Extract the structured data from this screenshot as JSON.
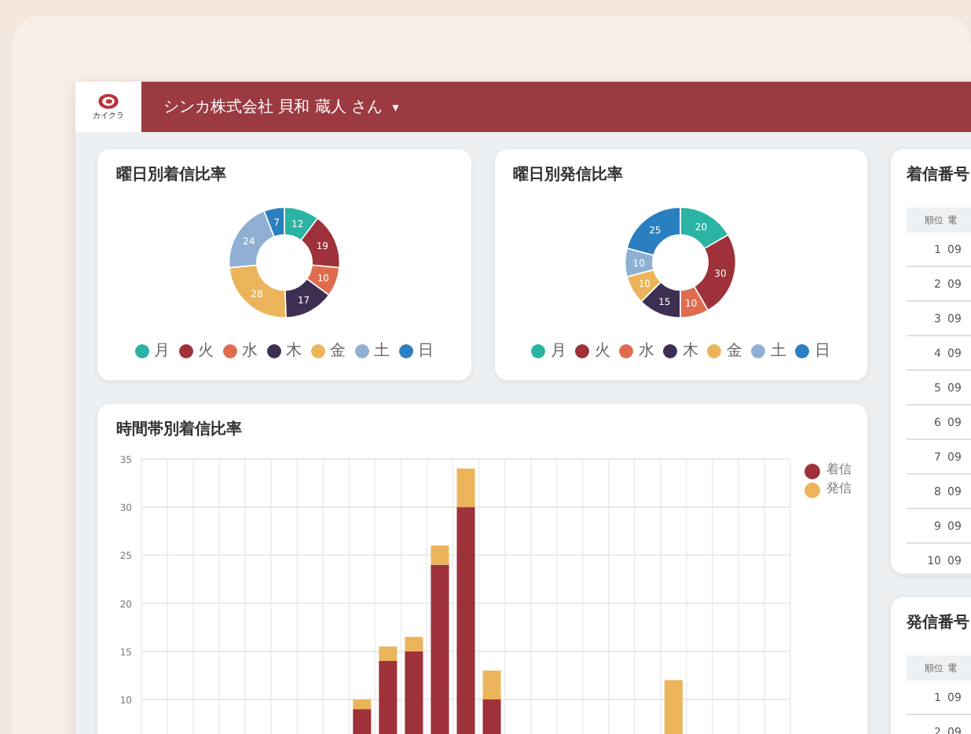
{
  "header": {
    "logo_text": "カイクラ",
    "user": "シンカ株式会社 貝和 蔵人 さん",
    "menu_caret": "▾"
  },
  "donuts": [
    {
      "chart_data": {
        "type": "donut",
        "title": "曜日別着信比率",
        "categories": [
          "月",
          "火",
          "水",
          "木",
          "金",
          "土",
          "日"
        ],
        "values": [
          12,
          19,
          10,
          17,
          28,
          24,
          7
        ],
        "colors": [
          "#2bb3a3",
          "#9e3139",
          "#e06c4f",
          "#3d2f52",
          "#ecb45a",
          "#8fb0d3",
          "#2a7fc0"
        ],
        "data_labels": true
      }
    },
    {
      "chart_data": {
        "type": "donut",
        "title": "曜日別発信比率",
        "categories": [
          "月",
          "火",
          "水",
          "木",
          "金",
          "土",
          "日"
        ],
        "values": [
          20,
          30,
          10,
          15,
          10,
          10,
          25
        ],
        "colors": [
          "#2bb3a3",
          "#9e3139",
          "#e06c4f",
          "#3d2f52",
          "#ecb45a",
          "#8fb0d3",
          "#2a7fc0"
        ],
        "data_labels": true
      }
    }
  ],
  "hourly": {
    "chart_data": {
      "type": "bar",
      "title": "時間帯別着信比率",
      "stacked": true,
      "grid": true,
      "legend": true,
      "ylim": [
        0,
        35
      ],
      "yticks": [
        10,
        15,
        20,
        25,
        30,
        35
      ],
      "series": [
        {
          "name": "着信",
          "color": "#9e3139",
          "values": [
            0,
            0,
            0,
            0,
            0,
            0,
            0,
            0,
            9,
            14,
            15,
            24,
            30,
            10,
            0,
            0,
            0,
            0,
            0,
            0,
            0,
            0,
            0,
            0,
            0
          ]
        },
        {
          "name": "発信",
          "color": "#ecb45a",
          "values": [
            0,
            0,
            0,
            0,
            0,
            0,
            0,
            0,
            1,
            1.5,
            1.5,
            2,
            4,
            3,
            0,
            0,
            0,
            0,
            0,
            0,
            12,
            0,
            0,
            0,
            0
          ]
        }
      ]
    }
  },
  "rankings": [
    {
      "title": "着信番号",
      "columns": [
        "順位",
        "電"
      ],
      "rows": [
        [
          "1",
          "09"
        ],
        [
          "2",
          "09"
        ],
        [
          "3",
          "09"
        ],
        [
          "4",
          "09"
        ],
        [
          "5",
          "09"
        ],
        [
          "6",
          "09"
        ],
        [
          "7",
          "09"
        ],
        [
          "8",
          "09"
        ],
        [
          "9",
          "09"
        ],
        [
          "10",
          "09"
        ]
      ]
    },
    {
      "title": "発信番号",
      "columns": [
        "順位",
        "電"
      ],
      "rows": [
        [
          "1",
          "09"
        ],
        [
          "2",
          "09"
        ]
      ]
    }
  ]
}
